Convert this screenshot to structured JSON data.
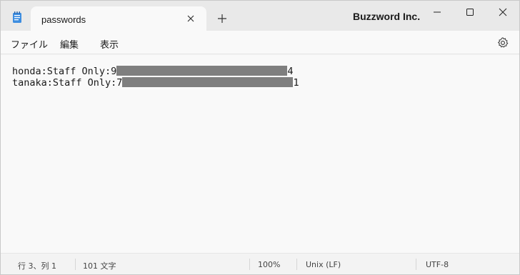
{
  "titlebar": {
    "tab_title": "passwords",
    "brand": "Buzzword Inc."
  },
  "menu": {
    "file": "ファイル",
    "edit": "編集",
    "view": "表示"
  },
  "editor": {
    "lines": [
      {
        "prefix": "honda:Staff Only:9",
        "suffix": "4"
      },
      {
        "prefix": "tanaka:Staff Only:7",
        "suffix": "1"
      }
    ],
    "redaction_color": "#7f7f7f"
  },
  "status": {
    "position": "行 3、列 1",
    "char_count": "101 文字",
    "zoom": "100%",
    "line_ending": "Unix (LF)",
    "encoding": "UTF-8"
  },
  "icons": {
    "app": "notepad-icon",
    "tab_close": "close-icon",
    "new_tab": "plus-icon",
    "minimize": "minimize-icon",
    "maximize": "maximize-icon",
    "close": "close-icon",
    "settings": "gear-icon"
  }
}
